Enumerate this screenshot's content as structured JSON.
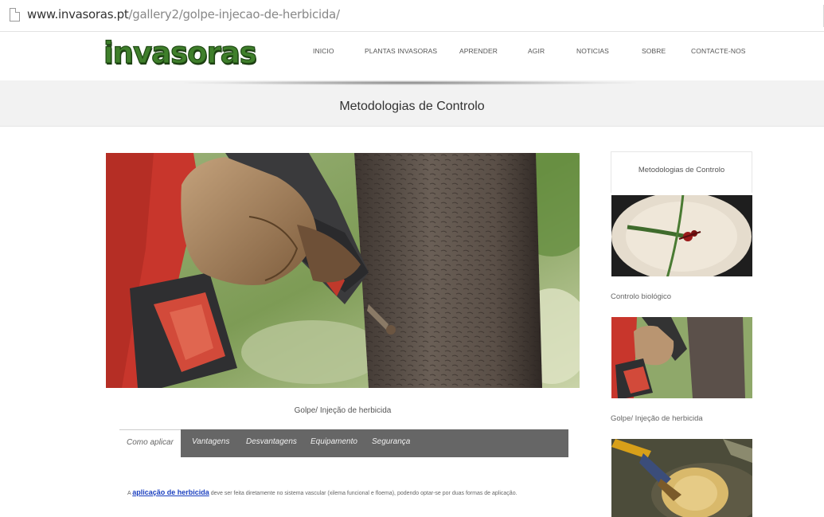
{
  "browser": {
    "url_host": "www.invasoras.pt",
    "url_path": "/gallery2/golpe-injecao-de-herbicida/"
  },
  "header": {
    "logo_text": "invasoras",
    "nav": [
      {
        "label": "INICIO"
      },
      {
        "label": "PLANTAS INVASORAS"
      },
      {
        "label": "APRENDER"
      },
      {
        "label": "AGIR"
      },
      {
        "label": "NOTICIAS"
      },
      {
        "label": "SOBRE"
      },
      {
        "label": "CONTACTE-NOS"
      }
    ]
  },
  "page": {
    "title": "Metodologias de Controlo"
  },
  "main": {
    "caption": "Golpe/ Injeção de herbicida",
    "tabs": [
      {
        "label": "Como aplicar",
        "active": true
      },
      {
        "label": "Vantagens",
        "active": false
      },
      {
        "label": "Desvantagens",
        "active": false
      },
      {
        "label": "Equipamento",
        "active": false
      },
      {
        "label": "Segurança",
        "active": false
      }
    ],
    "content": {
      "prefix": "A ",
      "link_text": "aplicação de herbicida",
      "text": " deve ser feita diretamente no sistema vascular (xilema funcional e floema), podendo optar-se por duas formas de aplicação."
    }
  },
  "sidebar": {
    "title": "Metodologias de Controlo",
    "items": [
      {
        "label": "Controlo biológico"
      },
      {
        "label": "Golpe/ Injeção de herbicida"
      },
      {
        "label": ""
      }
    ]
  },
  "colors": {
    "logo_green": "#3f7f2b",
    "tab_bar": "#666666",
    "link": "#1a3fbf"
  }
}
